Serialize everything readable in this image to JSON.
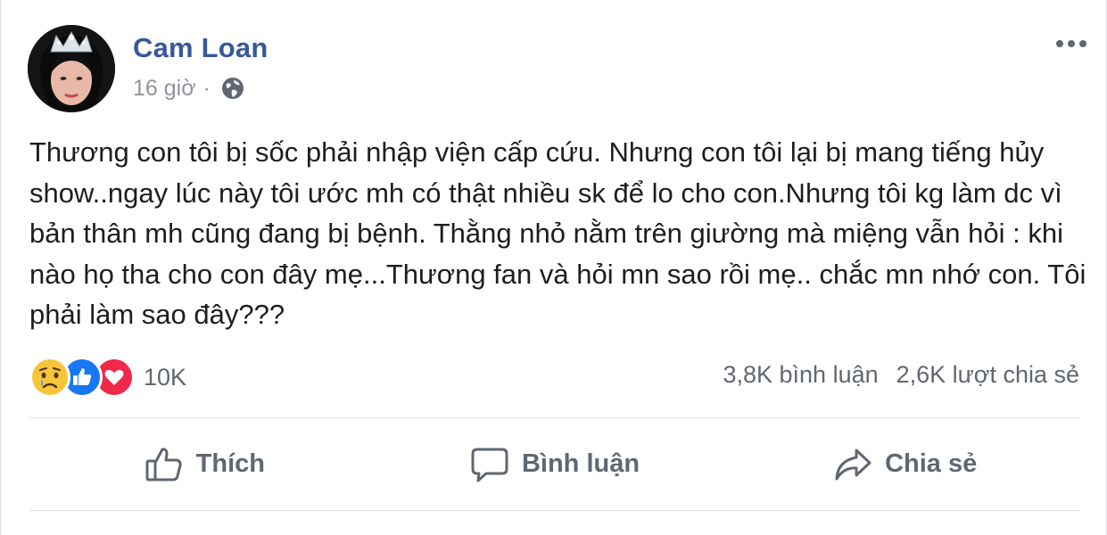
{
  "post": {
    "author": "Cam Loan",
    "time": "16 giờ",
    "separator": "·",
    "privacy_icon": "globe-icon",
    "text": "Thương con tôi bị sốc phải nhập viện cấp cứu. Nhưng con tôi lại bị mang tiếng hủy show..ngay lúc này tôi ước mh có thật nhiều sk để lo cho con.Nhưng tôi kg làm dc vì bản thân mh cũng đang bị bệnh. Thằng nhỏ nằm trên giường mà miệng vẫn hỏi : khi nào họ tha cho con đây mẹ...Thương fan và hỏi mn sao rồi mẹ.. chắc mn nhớ con. Tôi phải làm sao đây???"
  },
  "reactions": {
    "icons": [
      "sad-icon",
      "like-icon",
      "love-icon"
    ],
    "count": "10K"
  },
  "engagement": {
    "comments": "3,8K bình luận",
    "shares": "2,6K lượt chia sẻ"
  },
  "actions": {
    "like": "Thích",
    "comment": "Bình luận",
    "share": "Chia sẻ"
  },
  "colors": {
    "author_link": "#385898",
    "meta_text": "#90949c",
    "action_text": "#606770",
    "like_blue": "#1877f2",
    "love_red": "#f0284a",
    "sad_yellow": "#f7c53b"
  }
}
